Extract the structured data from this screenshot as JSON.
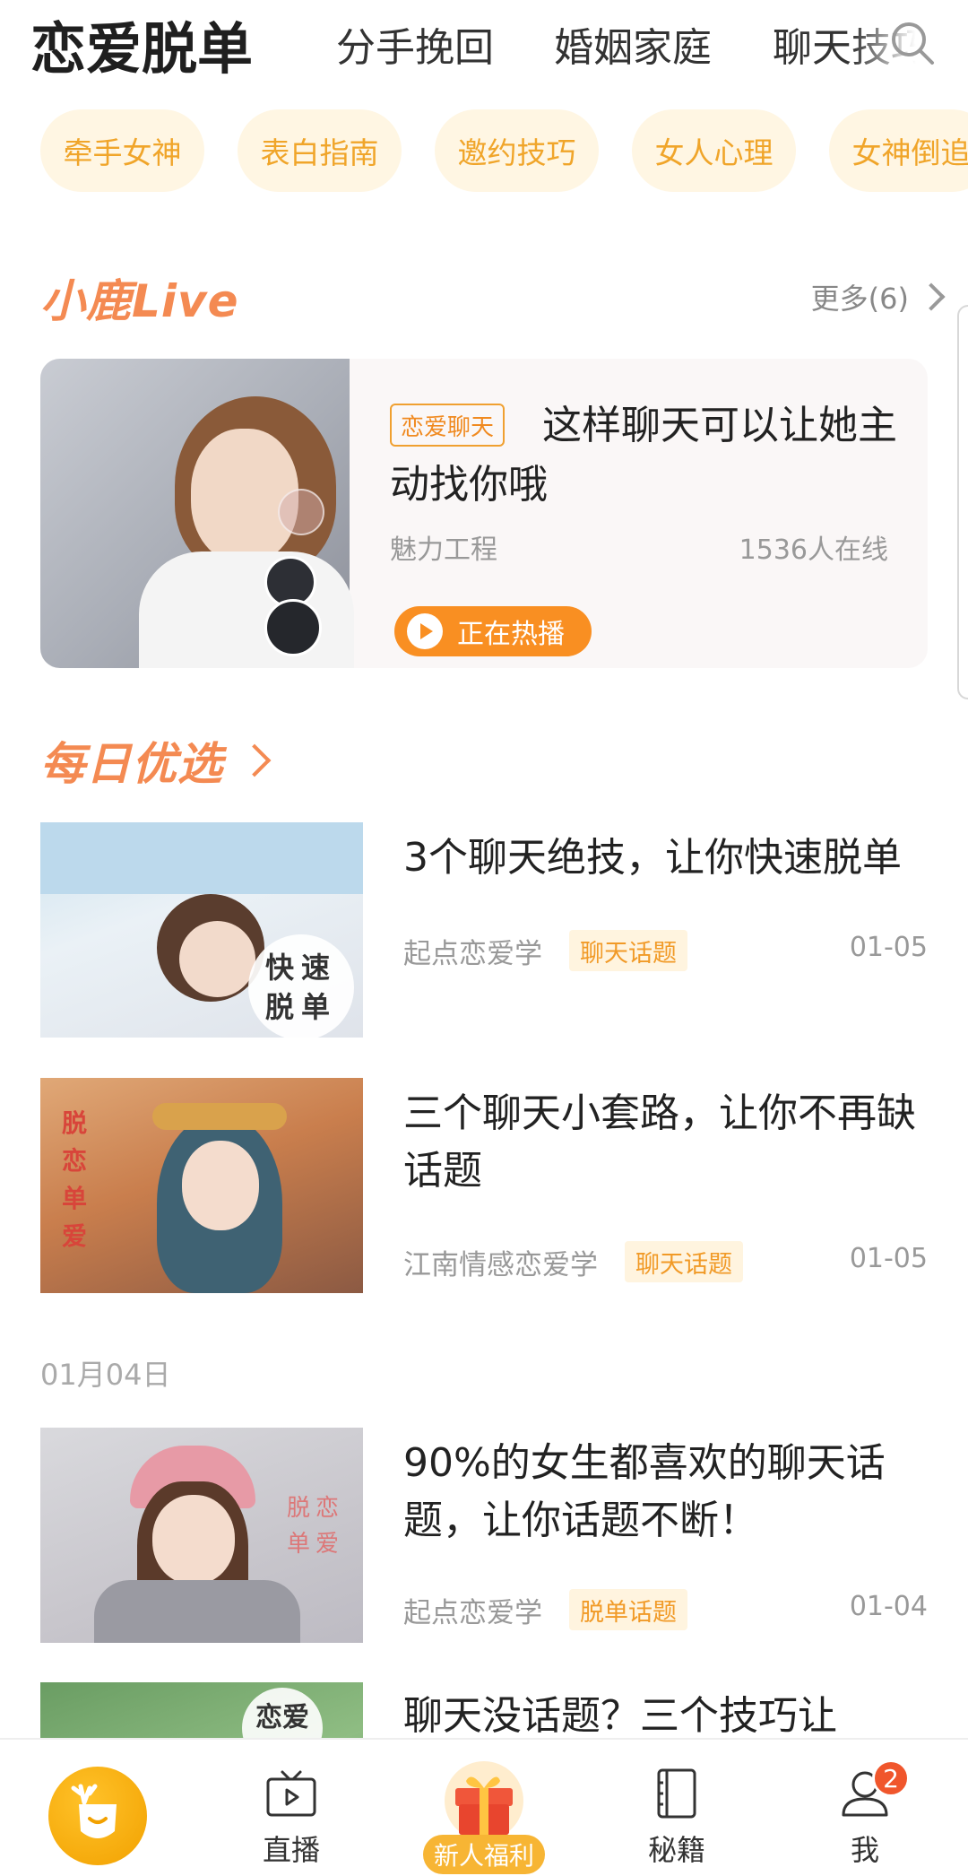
{
  "top_tabs": {
    "active": "恋爱脱单",
    "items": [
      "分手挽回",
      "婚姻家庭",
      "聊天技巧"
    ]
  },
  "icons": {
    "search": "search-icon",
    "more": "chevron-right-icon",
    "play": "play-icon",
    "home": "deer-icon",
    "live": "tv-icon",
    "gift": "gift-icon",
    "books": "book-icon",
    "me": "user-icon"
  },
  "chips": [
    "牵手女神",
    "表白指南",
    "邀约技巧",
    "女人心理",
    "女神倒追"
  ],
  "live_section": {
    "title": "小鹿Live",
    "more_label": "更多(6)",
    "card": {
      "tag": "恋爱聊天",
      "title": "这样聊天可以让她主动找你哦",
      "author": "魅力工程",
      "online": "1536人在线",
      "button": "正在热播"
    }
  },
  "daily_section": {
    "title": "每日优选"
  },
  "articles": [
    {
      "thumb_text": "快速脱单",
      "title": "3个聊天绝技，让你快速脱单",
      "author": "起点恋爱学",
      "category": "聊天话题",
      "date": "01-05"
    },
    {
      "thumb_text": "脱恋单爱",
      "title": "三个聊天小套路，让你不再缺话题",
      "author": "江南情感恋爱学",
      "category": "聊天话题",
      "date": "01-05"
    },
    {
      "thumb_text": "脱恋单爱",
      "title": "90%的女生都喜欢的聊天话题，让你话题不断！",
      "author": "起点恋爱学",
      "category": "脱单话题",
      "date": "01-04"
    },
    {
      "thumb_text": "恋爱",
      "title": "聊天没话题？三个技巧让",
      "author": "",
      "category": "",
      "date": ""
    }
  ],
  "date_separator": "01月04日",
  "bottom_nav": {
    "live": "直播",
    "gift": "新人福利",
    "books": "秘籍",
    "me": "我",
    "me_badge": "2"
  },
  "colors": {
    "accent": "#f98f22",
    "chip_bg": "#fff6e3",
    "section_title": "#f48a52",
    "badge_red": "#f0562c"
  }
}
